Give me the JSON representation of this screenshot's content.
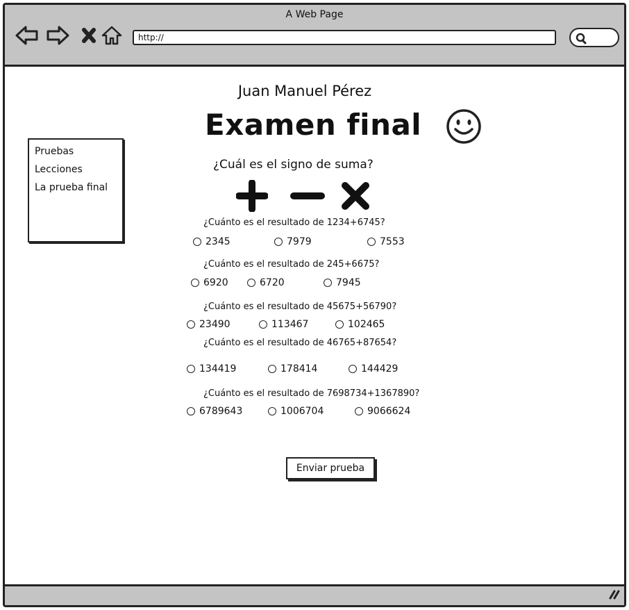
{
  "window": {
    "title": "A Web Page",
    "url": "http://"
  },
  "header": {
    "name": "Juan Manuel Pérez",
    "title": "Examen final"
  },
  "sidebar": {
    "items": [
      {
        "label": "Pruebas"
      },
      {
        "label": "Lecciones"
      },
      {
        "label": "La prueba final"
      }
    ]
  },
  "quiz": {
    "question1": {
      "label": "¿Cuál es el signo de suma?",
      "signs": [
        "plus-icon",
        "minus-icon",
        "times-icon"
      ]
    },
    "questions": [
      {
        "label": "¿Cuánto es el resultado de 1234+6745?",
        "options": [
          "2345",
          "7979",
          "7553"
        ]
      },
      {
        "label": "¿Cuánto es el resultado de 245+6675?",
        "options": [
          "6920",
          "6720",
          "7945"
        ]
      },
      {
        "label": "¿Cuánto es el resultado de 45675+56790?",
        "options": [
          "23490",
          "113467",
          "102465"
        ]
      },
      {
        "label": "¿Cuánto es el resultado de 46765+87654?",
        "options": [
          "134419",
          "178414",
          "144429"
        ]
      },
      {
        "label": "¿Cuánto es el resultado de 7698734+1367890?",
        "options": [
          "6789643",
          "1006704",
          "9066624"
        ]
      }
    ],
    "submit_label": "Enviar prueba"
  },
  "colors": {
    "chrome": "#c4c4c4",
    "ink": "#222222",
    "background": "#ffffff"
  }
}
